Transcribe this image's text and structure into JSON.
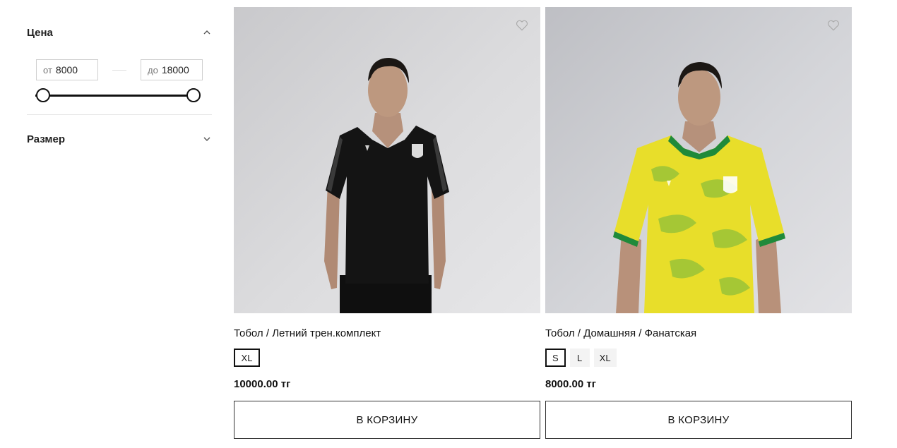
{
  "filters": {
    "price": {
      "title": "Цена",
      "from_prefix": "от",
      "from_value": "8000",
      "to_prefix": "до",
      "to_value": "18000",
      "expanded": true
    },
    "size": {
      "title": "Размер",
      "expanded": false
    }
  },
  "products": [
    {
      "name": "Тобол / Летний трен.комплект",
      "sizes": [
        "XL"
      ],
      "selected_size": "XL",
      "price": "10000.00 тг",
      "cart_label": "В КОРЗИНУ",
      "shirt_color": "#141414"
    },
    {
      "name": "Тобол / Домашняя / Фанатская",
      "sizes": [
        "S",
        "L",
        "XL"
      ],
      "selected_size": "S",
      "price": "8000.00 тг",
      "cart_label": "В КОРЗИНУ",
      "shirt_color": "#e8de2a"
    }
  ]
}
